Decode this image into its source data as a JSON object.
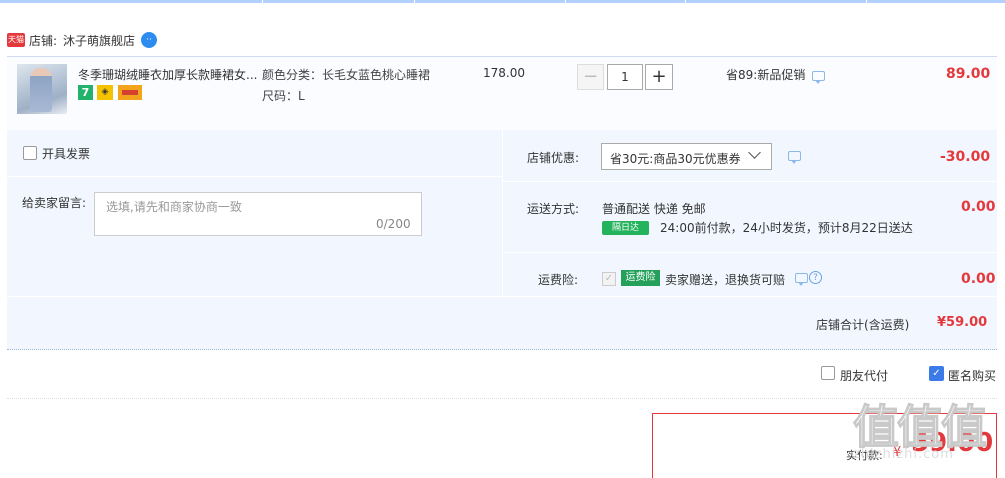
{
  "shop": {
    "badge": "天猫",
    "label": "店铺:",
    "name": "沐子萌旗舰店",
    "ww_icon": "wangwang-chat-icon"
  },
  "item": {
    "title": "冬季珊瑚绒睡衣加厚长款睡裙女...",
    "badge_seven": "7",
    "color_sku": "颜色分类：长毛女蓝色桃心睡裙",
    "size_sku": "尺码：L",
    "unit_price": "178.00",
    "qty_minus": "−",
    "quantity": "1",
    "qty_plus": "+",
    "promo": "省89:新品促销",
    "total": "89.00"
  },
  "options": {
    "invoice_label": "开具发票",
    "note_label": "给卖家留言:",
    "note_placeholder": "选填,请先和商家协商一致",
    "note_count": "0/200",
    "coupon_label": "店铺优惠:",
    "coupon_value": "省30元:商品30元优惠券",
    "coupon_amount": "-30.00",
    "shipping_label": "运送方式:",
    "shipping_method": "普通配送 快递 免邮",
    "next_day_badge": "隔日达",
    "shipping_promise": "24:00前付款，24小时发货，预计8月22日送达",
    "shipping_amount": "0.00",
    "insurance_label": "运费险:",
    "insurance_badge": "运费险",
    "insurance_text": "卖家赠送，退换货可赔",
    "insurance_amount": "0.00",
    "subtotal_label": "店铺合计(含运费)",
    "subtotal_amount": "¥59.00"
  },
  "bottom": {
    "friend_pay_label": "朋友代付",
    "anonymous_label": "匿名购买",
    "pay_label": "实付款:",
    "pay_currency": "¥",
    "pay_amount": "59.00"
  },
  "watermark": {
    "text": "值值值",
    "sub": "zhizhizhi.com"
  },
  "colors": {
    "price_red": "#e4393c",
    "panel_bg": "#f2f7ff",
    "accent_blue": "#3b7be9",
    "green_badge": "#24b35c"
  }
}
